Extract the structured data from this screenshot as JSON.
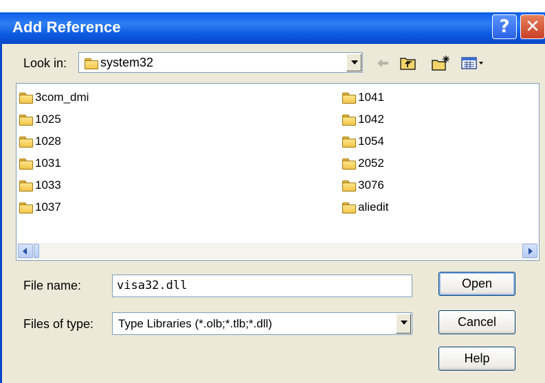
{
  "window": {
    "title": "Add Reference",
    "help_glyph": "?",
    "close_glyph": "✕"
  },
  "look_in": {
    "label": "Look in:",
    "value": "system32"
  },
  "toolbar": {
    "icons": [
      "back-arrow-icon",
      "up-folder-icon",
      "new-folder-icon",
      "view-menu-icon"
    ]
  },
  "files": {
    "column1": [
      "3com_dmi",
      "1025",
      "1028",
      "1031",
      "1033",
      "1037"
    ],
    "column2": [
      "1041",
      "1042",
      "1054",
      "2052",
      "3076",
      "aliedit"
    ]
  },
  "file_name": {
    "label": "File name:",
    "value": "visa32.dll"
  },
  "files_of_type": {
    "label": "Files of type:",
    "value": "Type Libraries (*.olb;*.tlb;*.dll)"
  },
  "buttons": {
    "open": "Open",
    "cancel": "Cancel",
    "help": "Help"
  }
}
